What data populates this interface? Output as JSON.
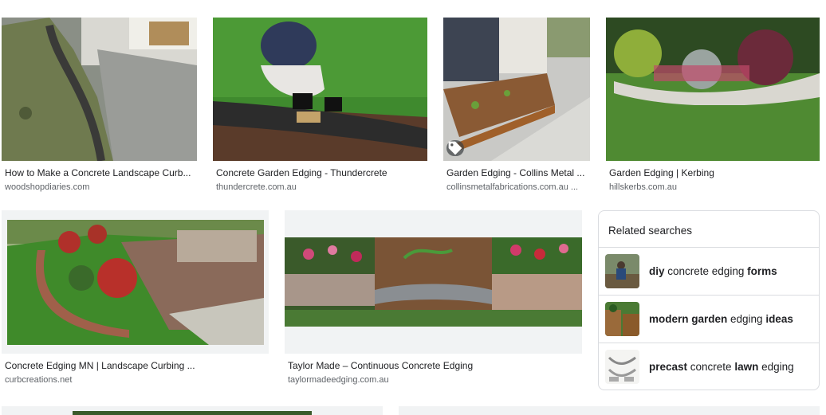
{
  "results_row1": [
    {
      "title": "How to Make a Concrete Landscape Curb...",
      "source": "woodshopdiaries.com"
    },
    {
      "title": "Concrete Garden Edging - Thundercrete",
      "source": "thundercrete.com.au"
    },
    {
      "title": "Garden Edging - Collins Metal ...",
      "source": "collinsmetalfabrications.com.au ..."
    },
    {
      "title": "Garden Edging | Kerbing",
      "source": "hillskerbs.com.au"
    }
  ],
  "results_row2": [
    {
      "title": "Concrete Edging MN | Landscape Curbing ...",
      "source": "curbcreations.net"
    },
    {
      "title": "Taylor Made – Continuous Concrete Edging",
      "source": "taylormadeedging.com.au"
    }
  ],
  "related": {
    "header": "Related searches",
    "items": [
      {
        "parts": [
          {
            "t": "diy",
            "b": true
          },
          {
            "t": " concrete edging ",
            "b": false
          },
          {
            "t": "forms",
            "b": true
          }
        ]
      },
      {
        "parts": [
          {
            "t": "modern garden",
            "b": true
          },
          {
            "t": " edging ",
            "b": false
          },
          {
            "t": "ideas",
            "b": true
          }
        ]
      },
      {
        "parts": [
          {
            "t": "precast",
            "b": true
          },
          {
            "t": " concrete ",
            "b": false
          },
          {
            "t": "lawn",
            "b": true
          },
          {
            "t": " edging",
            "b": false
          }
        ]
      }
    ]
  },
  "icons": {
    "product_tag": "tag-icon"
  },
  "colors": {
    "title_text": "#202124",
    "source_text": "#5f6368",
    "border": "#dadce0"
  }
}
